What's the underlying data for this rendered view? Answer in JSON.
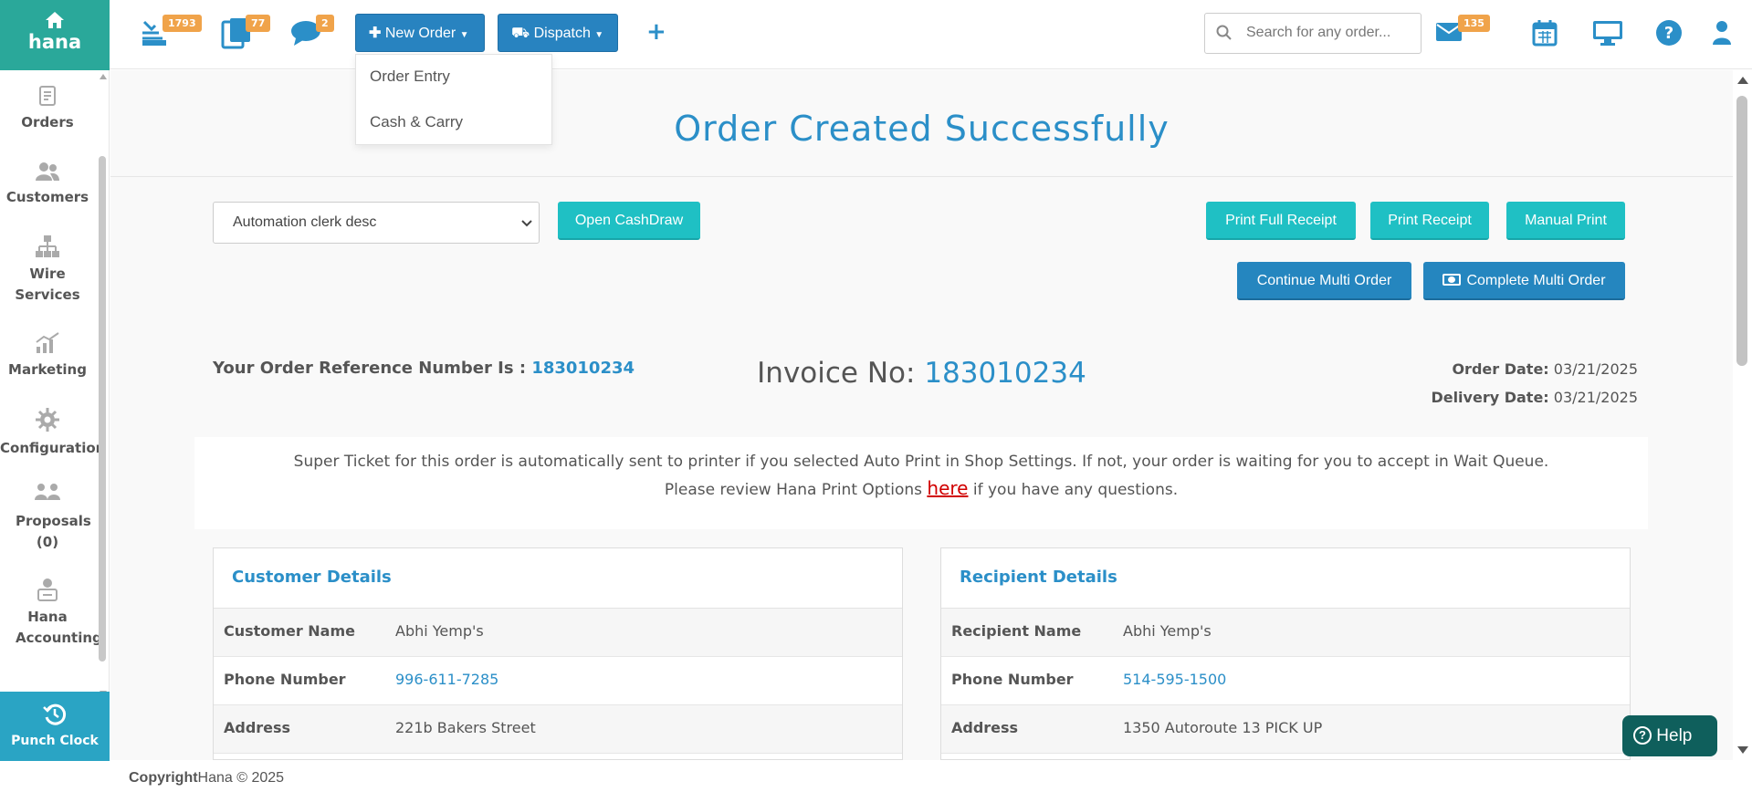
{
  "brand": {
    "name": "hana"
  },
  "topbar": {
    "badges": {
      "orders_count": "1793",
      "documents_count": "77",
      "messages_count": "2",
      "mail_count": "135"
    },
    "new_order_label": "New Order",
    "dispatch_label": "Dispatch",
    "search": {
      "placeholder": "Search for any order..."
    }
  },
  "dropdown": {
    "items": [
      {
        "label": "Order Entry"
      },
      {
        "label": "Cash & Carry"
      }
    ]
  },
  "sidebar": {
    "items": [
      {
        "label": "Orders"
      },
      {
        "label": "Customers"
      },
      {
        "label": "Wire Services"
      },
      {
        "label": "Marketing"
      },
      {
        "label": "Configuration"
      },
      {
        "label": "Proposals (0)"
      },
      {
        "label": "Hana Accounting"
      }
    ],
    "punch_label": "Punch Clock"
  },
  "main": {
    "title": "Order Created Successfully",
    "clerk_select_value": "Automation clerk desc",
    "buttons": {
      "open_cashdraw": "Open CashDraw",
      "print_full_receipt": "Print Full Receipt",
      "print_receipt": "Print Receipt",
      "manual_print": "Manual Print",
      "continue_multi_order": "Continue Multi Order",
      "complete_multi_order": "Complete Multi Order"
    },
    "reference_label": "Your Order Reference Number Is :",
    "reference_number": "183010234",
    "invoice_label": "Invoice No:",
    "invoice_number": "183010234",
    "order_date_label": "Order Date:",
    "order_date": "03/21/2025",
    "delivery_date_label": "Delivery Date:",
    "delivery_date": "03/21/2025",
    "notice_line1": "Super Ticket for this order is automatically sent to printer if you selected Auto Print in Shop Settings. If not, your order is waiting for you to accept in Wait Queue.",
    "notice_line2_prefix": "Please review Hana Print Options",
    "notice_link": "here",
    "notice_line2_suffix": "if you have any questions."
  },
  "customer_details": {
    "title": "Customer Details",
    "rows": [
      {
        "label": "Customer Name",
        "value": "Abhi Yemp's"
      },
      {
        "label": "Phone Number",
        "value": "996-611-7285"
      },
      {
        "label": "Address",
        "value": "221b Bakers Street"
      }
    ]
  },
  "recipient_details": {
    "title": "Recipient Details",
    "rows": [
      {
        "label": "Recipient Name",
        "value": "Abhi Yemp's"
      },
      {
        "label": "Phone Number",
        "value": "514-595-1500"
      },
      {
        "label": "Address",
        "value": "1350 Autoroute 13 PICK UP"
      }
    ]
  },
  "help_label": "Help",
  "footer": {
    "copyright_label": "Copyright",
    "copyright_text": "Hana © 2025"
  },
  "colors": {
    "accent": "#2b8fc8",
    "brand": "#2aa89a",
    "teal_button": "#1fc0c4",
    "badge": "#f0a34a",
    "link_red": "#d10000"
  }
}
